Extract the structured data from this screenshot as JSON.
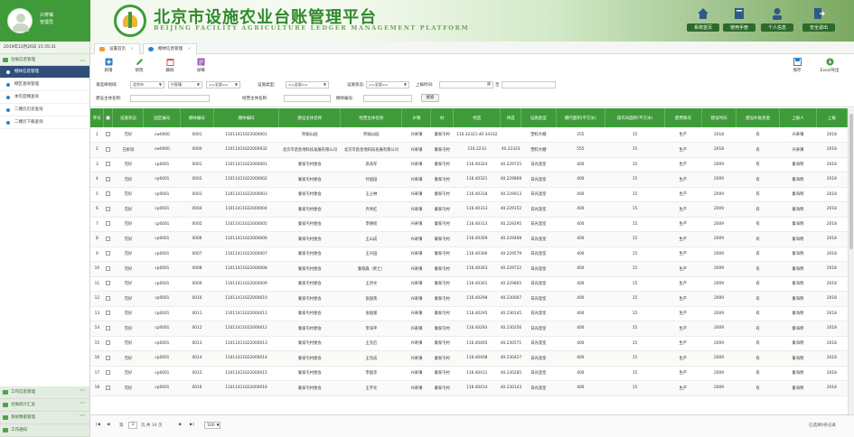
{
  "header": {
    "user_name": "兴寿镇",
    "user_role": "管理员",
    "title": "北京市设施农业台账管理平台",
    "subtitle": "BEIJING FACILITY AGRICULTURE LEDGER MANAGEMENT PLATFORM",
    "buttons": [
      {
        "label": "系统首页",
        "icon": "home-icon"
      },
      {
        "label": "使用手册",
        "icon": "book-icon"
      },
      {
        "label": "个人信息",
        "icon": "user-icon"
      },
      {
        "label": "安全退出",
        "icon": "logout-icon"
      }
    ]
  },
  "sidebar": {
    "datetime": "2019年12月26日 15:35:31",
    "group_main": "台账信息管理",
    "items": [
      "棚体信息管理",
      "棚区基地管理",
      "本年度棚查询",
      "二棚历历史查询",
      "二棚历下载查询"
    ],
    "bottom_groups": [
      "工作信息管理",
      "台账统计汇总",
      "系统数据管理",
      "工作通知"
    ]
  },
  "tabs": [
    {
      "label": "设置首页",
      "close": "×"
    },
    {
      "label": "棚体信息管理",
      "close": "×"
    }
  ],
  "toolbar": {
    "left": [
      {
        "label": "新增",
        "icon": "add-icon"
      },
      {
        "label": "修改",
        "icon": "edit-icon"
      },
      {
        "label": "删除",
        "icon": "delete-icon"
      },
      {
        "label": "详细",
        "icon": "detail-icon"
      }
    ],
    "right": [
      {
        "label": "保存",
        "icon": "save-icon"
      },
      {
        "label": "Excel导出",
        "icon": "export-icon"
      }
    ]
  },
  "filters": {
    "row1": [
      {
        "label": "请选择地域:",
        "value": ""
      },
      {
        "label": "",
        "value": "北京市"
      },
      {
        "label": "",
        "value": "兴寿镇"
      },
      {
        "label": "",
        "value": "==全部=="
      },
      {
        "label": "设施类型:",
        "value": "==全部=="
      },
      {
        "label": "设施状态:",
        "value": "==全部=="
      },
      {
        "label": "上报时间:",
        "value": ""
      }
    ],
    "row2": [
      {
        "label": "建设主体名称:",
        "value": ""
      },
      {
        "label": "经营主体名称:",
        "value": ""
      },
      {
        "label": "棚体编号:",
        "value": ""
      }
    ],
    "query_button": "搜索",
    "date_sep": "至"
  },
  "table": {
    "columns": [
      "序号",
      "",
      "设施状态",
      "园区编号",
      "棚体编号",
      "棚体编码",
      "建设主体名称",
      "经营主体名称",
      "乡镇",
      "村",
      "经度",
      "纬度",
      "设施类型",
      "棚内面积(平方米)",
      "操作间面积(平方米)",
      "使用情况",
      "建设时间",
      "建设补贴资金",
      "上报人",
      "上报"
    ],
    "rows": [
      [
        "1",
        "",
        "完好",
        "cw0000",
        "0001",
        "11011411622000001",
        "明丽山园",
        "明丽山园",
        "兴寿镇",
        "秦家屯村",
        "116.32321:40.34332",
        "",
        "塑料大棚",
        "255",
        "15",
        "生产",
        "2018",
        "有",
        "兴寿镇",
        "2018"
      ],
      [
        "2",
        "",
        "已拆除",
        "cw0000",
        "0000",
        "11011411622000032",
        "北京市昌金地科技发展有限公司",
        "北京市昌金地科技发展有限公司",
        "兴寿镇",
        "秦家屯村",
        "116.2233",
        "40.22323",
        "塑料大棚",
        "555",
        "15",
        "生产",
        "2018",
        "有",
        "兴寿镇",
        "2018"
      ],
      [
        "3",
        "",
        "完好",
        "cp0001",
        "0001",
        "11011411622000001",
        "秦家屯村委会",
        "高海军",
        "兴寿镇",
        "秦家屯村",
        "116.40324",
        "40.229725",
        "日光温室",
        "400",
        "15",
        "生产",
        "2009",
        "有",
        "秦海明",
        "2018"
      ],
      [
        "4",
        "",
        "完好",
        "cp0001",
        "0002",
        "11011411622000002",
        "秦家屯村委会",
        "付国田",
        "兴寿镇",
        "秦家屯村",
        "116.40321",
        "40.229868",
        "日光温室",
        "400",
        "15",
        "生产",
        "2009",
        "有",
        "秦海明",
        "2018"
      ],
      [
        "5",
        "",
        "完好",
        "cp0001",
        "0003",
        "11011411622000003",
        "秦家屯村委会",
        "王占林",
        "兴寿镇",
        "秦家屯村",
        "116.40318",
        "40.229913",
        "日光温室",
        "400",
        "15",
        "生产",
        "2009",
        "有",
        "秦海明",
        "2018"
      ],
      [
        "6",
        "",
        "完好",
        "cp0001",
        "0004",
        "11011411622000004",
        "秦家屯村委会",
        "齐秀红",
        "兴寿镇",
        "秦家屯村",
        "116.40313",
        "40.229152",
        "日光温室",
        "400",
        "15",
        "生产",
        "2009",
        "有",
        "秦海明",
        "2018"
      ],
      [
        "7",
        "",
        "完好",
        "cp0001",
        "0005",
        "11011411622000005",
        "秦家屯村委会",
        "李德权",
        "兴寿镇",
        "秦家屯村",
        "116.40313",
        "40.229295",
        "日光温室",
        "400",
        "15",
        "生产",
        "2009",
        "有",
        "秦海明",
        "2018"
      ],
      [
        "8",
        "",
        "完好",
        "cp0001",
        "0006",
        "11011411622000006",
        "秦家屯村委会",
        "王山成",
        "兴寿镇",
        "秦家屯村",
        "116.40309",
        "40.229408",
        "日光温室",
        "400",
        "15",
        "生产",
        "2009",
        "有",
        "秦海明",
        "2018"
      ],
      [
        "9",
        "",
        "完好",
        "cp0001",
        "0007",
        "11011411622000007",
        "秦家屯村委会",
        "王兴田",
        "兴寿镇",
        "秦家屯村",
        "116.40306",
        "40.229579",
        "日光温室",
        "400",
        "15",
        "生产",
        "2009",
        "有",
        "秦海明",
        "2018"
      ],
      [
        "10",
        "",
        "完好",
        "cp0001",
        "0008",
        "11011411622000008",
        "秦家屯村委会",
        "秦保森（死亡）",
        "兴寿镇",
        "秦家屯村",
        "116.40303",
        "40.229722",
        "日光温室",
        "400",
        "15",
        "生产",
        "2009",
        "有",
        "秦海明",
        "2018"
      ],
      [
        "11",
        "",
        "完好",
        "cp0001",
        "0009",
        "11011411622000009",
        "秦家屯村委会",
        "王洪文",
        "兴寿镇",
        "秦家屯村",
        "116.40301",
        "40.229865",
        "日光温室",
        "400",
        "15",
        "生产",
        "2009",
        "有",
        "秦海明",
        "2018"
      ],
      [
        "12",
        "",
        "完好",
        "cp0001",
        "0010",
        "11011411622000010",
        "秦家屯村委会",
        "张国英",
        "兴寿镇",
        "秦家屯村",
        "116.40298",
        "40.230007",
        "日光温室",
        "400",
        "15",
        "生产",
        "2009",
        "有",
        "秦海明",
        "2018"
      ],
      [
        "13",
        "",
        "完好",
        "cp0001",
        "0011",
        "11011411622000011",
        "秦家屯村委会",
        "张国富",
        "兴寿镇",
        "秦家屯村",
        "116.40295",
        "40.230145",
        "日光温室",
        "400",
        "15",
        "生产",
        "2009",
        "有",
        "秦海明",
        "2018"
      ],
      [
        "14",
        "",
        "完好",
        "cp0001",
        "0012",
        "11011411622000012",
        "秦家屯村委会",
        "李海平",
        "兴寿镇",
        "秦家屯村",
        "116.40293",
        "40.230256",
        "日光温室",
        "400",
        "15",
        "生产",
        "2009",
        "有",
        "秦海明",
        "2018"
      ],
      [
        "15",
        "",
        "完好",
        "cp0001",
        "0013",
        "11011411622000013",
        "秦家屯村委会",
        "王克启",
        "兴寿镇",
        "秦家屯村",
        "116.40405",
        "40.230571",
        "日光温室",
        "400",
        "15",
        "生产",
        "2009",
        "有",
        "秦海明",
        "2018"
      ],
      [
        "16",
        "",
        "完好",
        "cp0001",
        "0014",
        "11011411622000014",
        "秦家屯村委会",
        "王克成",
        "兴寿镇",
        "秦家屯村",
        "116.40408",
        "40.230427",
        "日光温室",
        "400",
        "15",
        "生产",
        "2009",
        "有",
        "秦海明",
        "2018"
      ],
      [
        "17",
        "",
        "完好",
        "cp0001",
        "0015",
        "11011411622000015",
        "秦家屯村委会",
        "李国华",
        "兴寿镇",
        "秦家屯村",
        "116.40411",
        "40.230285",
        "日光温室",
        "400",
        "15",
        "生产",
        "2009",
        "有",
        "秦海明",
        "2018"
      ],
      [
        "18",
        "",
        "完好",
        "cp0001",
        "0016",
        "11011411622000016",
        "秦家屯村委会",
        "王宇文",
        "兴寿镇",
        "秦家屯村",
        "116.40414",
        "40.230143",
        "日光温室",
        "400",
        "15",
        "生产",
        "2009",
        "有",
        "秦海明",
        "2018"
      ]
    ]
  },
  "pager": {
    "first": "|◀",
    "prev": "◀",
    "page_label_pre": "第",
    "current_page": "1",
    "page_label_post": "页,共 34 页",
    "next": "▶",
    "last": "▶|",
    "page_size": "100",
    "right_text": "已选择0条记录"
  },
  "colors": {
    "primary_green": "#3f9b3a",
    "active_menu": "#2f4f7a"
  }
}
